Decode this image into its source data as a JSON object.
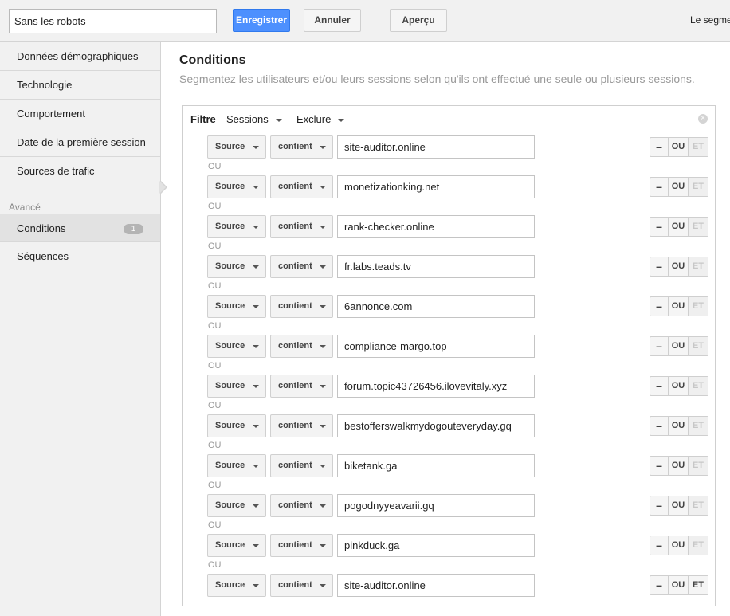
{
  "topbar": {
    "segment_name": "Sans les robots",
    "save_label": "Enregistrer",
    "cancel_label": "Annuler",
    "preview_label": "Aperçu",
    "note": "Le segmen"
  },
  "sidebar": {
    "items": [
      {
        "label": "Données démographiques"
      },
      {
        "label": "Technologie"
      },
      {
        "label": "Comportement"
      },
      {
        "label": "Date de la première session"
      },
      {
        "label": "Sources de trafic"
      }
    ],
    "advanced_label": "Avancé",
    "advanced_items": [
      {
        "label": "Conditions",
        "badge": "1"
      },
      {
        "label": "Séquences"
      }
    ]
  },
  "main": {
    "title": "Conditions",
    "subtitle": "Segmentez les utilisateurs et/ou leurs sessions selon qu'ils ont effectué une seule ou plusieurs sessions."
  },
  "filter": {
    "label": "Filtre",
    "scope": "Sessions",
    "mode": "Exclure",
    "or_separator": "OU",
    "minus_label": "–",
    "or_label": "OU",
    "and_label": "ET",
    "conditions": [
      {
        "dimension": "Source",
        "operator": "contient",
        "value": "site-auditor.online"
      },
      {
        "dimension": "Source",
        "operator": "contient",
        "value": "monetizationking.net"
      },
      {
        "dimension": "Source",
        "operator": "contient",
        "value": "rank-checker.online"
      },
      {
        "dimension": "Source",
        "operator": "contient",
        "value": "fr.labs.teads.tv"
      },
      {
        "dimension": "Source",
        "operator": "contient",
        "value": "6annonce.com"
      },
      {
        "dimension": "Source",
        "operator": "contient",
        "value": "compliance-margo.top"
      },
      {
        "dimension": "Source",
        "operator": "contient",
        "value": "forum.topic43726456.ilovevitaly.xyz"
      },
      {
        "dimension": "Source",
        "operator": "contient",
        "value": "bestofferswalkmydogouteveryday.gq"
      },
      {
        "dimension": "Source",
        "operator": "contient",
        "value": "biketank.ga"
      },
      {
        "dimension": "Source",
        "operator": "contient",
        "value": "pogodnyyeavarii.gq"
      },
      {
        "dimension": "Source",
        "operator": "contient",
        "value": "pinkduck.ga"
      },
      {
        "dimension": "Source",
        "operator": "contient",
        "value": "site-auditor.online"
      }
    ]
  },
  "colors": {
    "primary_button": "#4d90fe",
    "sidebar_bg": "#f1f1f1",
    "subtitle": "#999999"
  }
}
